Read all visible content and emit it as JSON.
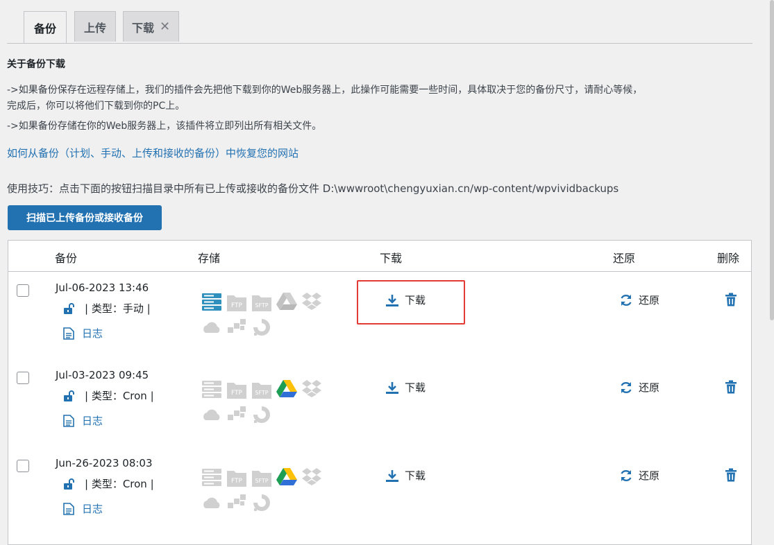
{
  "tabs": [
    {
      "label": "备份",
      "active": true
    },
    {
      "label": "上传",
      "active": false
    },
    {
      "label": "下载",
      "active": false,
      "close": "✕"
    }
  ],
  "about": {
    "title": "关于备份下载",
    "line1": "->如果备份保存在远程存储上，我们的插件会先把他下载到你的Web服务器上，此操作可能需要一些时间，具体取决于您的备份尺寸，请耐心等候，",
    "line1b": "完成后，你可以将他们下载到你的PC上。",
    "line2": "->如果备份存储在你的Web服务器上，该插件将立即列出所有相关文件。"
  },
  "restore_link": "如何从备份（计划、手动、上传和接收的备份）中恢复您的网站",
  "tip": "使用技巧：点击下面的按钮扫描目录中所有已上传或接收的备份文件 D:\\wwwroot\\chengyuxian.cn/wp-content/wpvividbackups",
  "scan_button": "扫描已上传备份或接收备份",
  "table": {
    "headers": {
      "backup": "备份",
      "storage": "存储",
      "download": "下载",
      "restore": "还原",
      "delete": "删除"
    },
    "rows": [
      {
        "date": "Jul-06-2023 13:46",
        "type": "| 类型：手动 |",
        "log": "日志",
        "download": "下载",
        "restore": "还原",
        "local_active": true,
        "gdrive_active": false
      },
      {
        "date": "Jul-03-2023 09:45",
        "type": "| 类型：Cron |",
        "log": "日志",
        "download": "下载",
        "restore": "还原",
        "local_active": false,
        "gdrive_active": true
      },
      {
        "date": "Jun-26-2023 08:03",
        "type": "| 类型：Cron |",
        "log": "日志",
        "download": "下载",
        "restore": "还原",
        "local_active": false,
        "gdrive_active": true
      }
    ]
  },
  "storage_icons": [
    "server-icon",
    "ftp-icon",
    "sftp-icon",
    "google-drive-icon",
    "dropbox-icon",
    "onedrive-icon",
    "s3-icon",
    "digitalocean-icon"
  ],
  "colors": {
    "accent": "#2271b1",
    "highlight": "#e53935",
    "local": "#2f8fbd",
    "inactive": "#d0d0d0"
  },
  "icons": {
    "lock": "unlock-icon",
    "log": "file-text-icon",
    "download": "download-icon",
    "restore": "refresh-icon",
    "delete": "trash-icon"
  }
}
